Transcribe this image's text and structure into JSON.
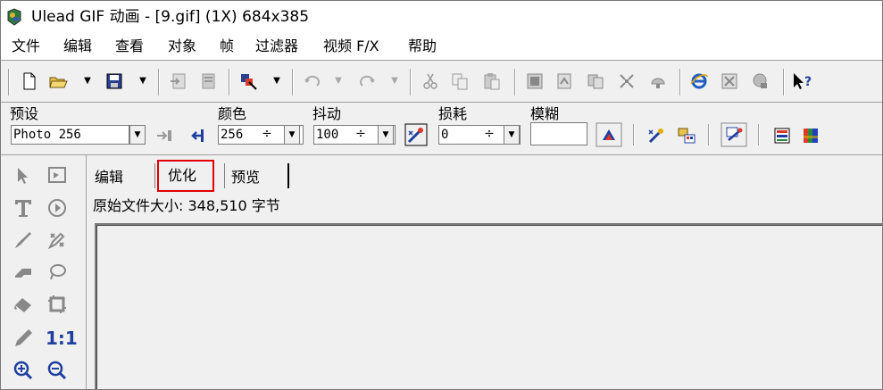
{
  "window": {
    "title": "Ulead GIF 动画 - [9.gif] (1X) 684x385"
  },
  "menu": [
    "文件",
    "编辑",
    "查看",
    "对象",
    "帧",
    "过滤器",
    "视频 F/X",
    "帮助"
  ],
  "toolbar": {
    "icons": [
      "new-file-icon",
      "open-folder-icon",
      "save-icon",
      "import-icon",
      "export-icon",
      "wizard-icon",
      "undo-icon",
      "redo-icon",
      "cut-icon",
      "copy-icon",
      "paste-icon",
      "frame-icon",
      "optimize-icon",
      "split-icon",
      "merge-icon",
      "crop-icon",
      "ie-preview-icon",
      "batch-icon",
      "clear-icon",
      "help-pointer-icon"
    ]
  },
  "options": {
    "preset_label": "预设",
    "preset_value": "Photo 256",
    "color_label": "颜色",
    "color_value": "256",
    "dither_label": "抖动",
    "dither_value": "100",
    "loss_label": "损耗",
    "loss_value": "0",
    "blur_label": "模糊",
    "blur_value": ""
  },
  "tabs": {
    "editor": "编辑",
    "optimize": "优化",
    "preview": "预览"
  },
  "file_info": "原始文件大小: 348,510 字节",
  "palette": {
    "ratio_label": "1:1"
  },
  "colors": {
    "accent_highlight": "#e00000",
    "ui_gray": "#f0f0f0",
    "icon_blue": "#1f3f9f"
  }
}
